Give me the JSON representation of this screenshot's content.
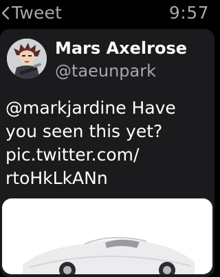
{
  "nav": {
    "back_label": "Tweet",
    "back_icon": "chevron-left-icon",
    "time": "9:57"
  },
  "tweet": {
    "author_name": "Mars Axelrose",
    "author_handle": "@taeunpark",
    "text": "@markjardine Have\nyou seen this yet?\npic.twitter.com/\nrtoHkLkANn",
    "media_alt": "photo of a white sports car"
  },
  "colors": {
    "background": "#000000",
    "card": "#1b1b1d",
    "secondary_text": "#a7a7ac",
    "primary_text": "#ffffff"
  }
}
